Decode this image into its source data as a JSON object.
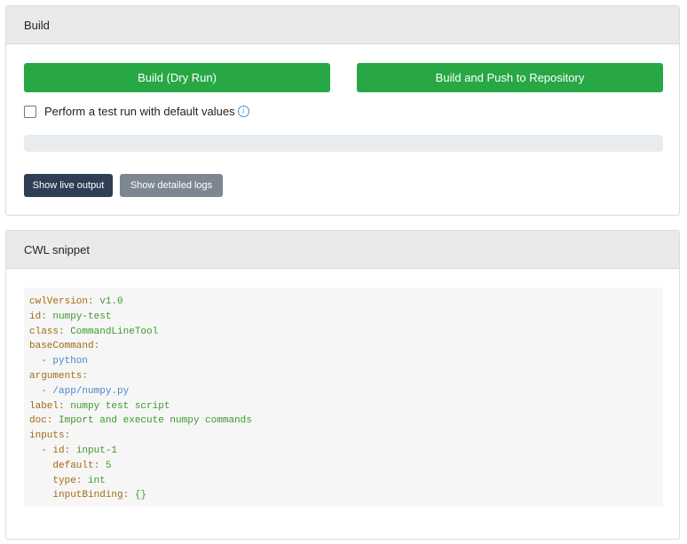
{
  "build_card": {
    "title": "Build",
    "dry_run_label": "Build (Dry Run)",
    "push_label": "Build and Push to Repository",
    "test_run_label": "Perform a test run with default values",
    "test_run_checked": false,
    "info_glyph": "i",
    "progress_percent": 0,
    "show_live_label": "Show live output",
    "show_logs_label": "Show detailed logs"
  },
  "cwl_card": {
    "title": "CWL snippet",
    "lines": [
      {
        "indent": "",
        "dash": "",
        "key": "cwlVersion:",
        "value": " v1.0"
      },
      {
        "indent": "",
        "dash": "",
        "key": "id:",
        "value": " numpy-test"
      },
      {
        "indent": "",
        "dash": "",
        "key": "class:",
        "value": " CommandLineTool"
      },
      {
        "indent": "",
        "dash": "",
        "key": "baseCommand:",
        "value": ""
      },
      {
        "indent": "  ",
        "dash": "- ",
        "key": "",
        "value": "python"
      },
      {
        "indent": "",
        "dash": "",
        "key": "arguments:",
        "value": ""
      },
      {
        "indent": "  ",
        "dash": "- ",
        "key": "",
        "value": "/app/numpy.py"
      },
      {
        "indent": "",
        "dash": "",
        "key": "label:",
        "value": " numpy test script"
      },
      {
        "indent": "",
        "dash": "",
        "key": "doc:",
        "value": " Import and execute numpy commands"
      },
      {
        "indent": "",
        "dash": "",
        "key": "inputs:",
        "value": ""
      },
      {
        "indent": "  ",
        "dash": "- ",
        "key": "id:",
        "value": " input-1"
      },
      {
        "indent": "    ",
        "dash": "",
        "key": "default:",
        "value": " 5"
      },
      {
        "indent": "    ",
        "dash": "",
        "key": "type:",
        "value": " int"
      },
      {
        "indent": "    ",
        "dash": "",
        "key": "inputBinding:",
        "value": " {}"
      }
    ]
  },
  "colors": {
    "primary_green": "#28a745",
    "dark_button": "#2e3e54",
    "gray_button": "#7d8793",
    "yaml_key": "#a26a14",
    "yaml_value": "#3c9a2c",
    "yaml_dash": "#4a87c7",
    "info_blue": "#3d8fd6"
  }
}
